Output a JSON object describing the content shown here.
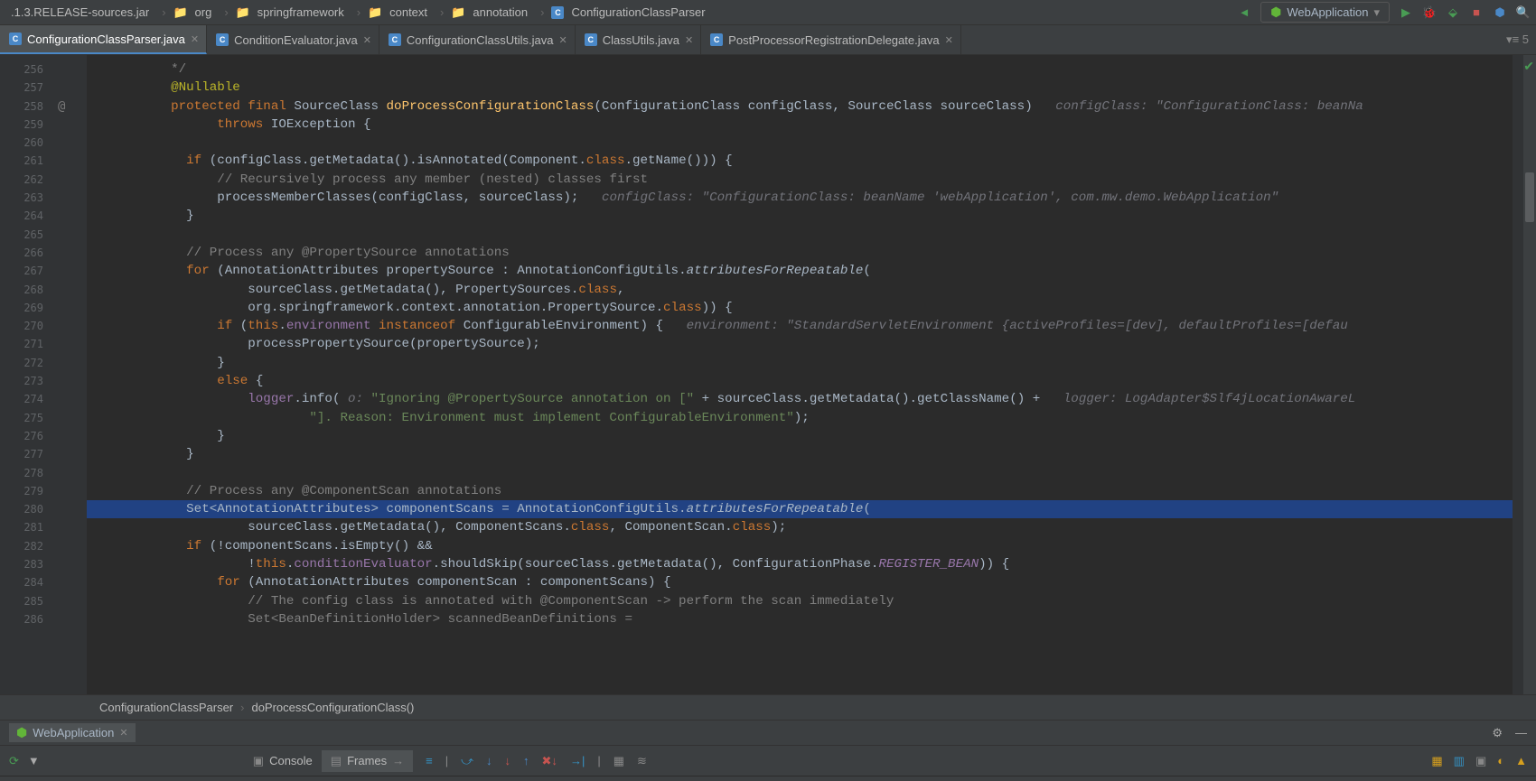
{
  "topbar": {
    "crumbs": [
      ".1.3.RELEASE-sources.jar",
      "org",
      "springframework",
      "context",
      "annotation",
      "ConfigurationClassParser"
    ],
    "runConfig": "WebApplication",
    "tabCount": "5"
  },
  "tabs": [
    {
      "label": "ConfigurationClassParser.java",
      "active": true
    },
    {
      "label": "ConditionEvaluator.java",
      "active": false
    },
    {
      "label": "ConfigurationClassUtils.java",
      "active": false
    },
    {
      "label": "ClassUtils.java",
      "active": false
    },
    {
      "label": "PostProcessorRegistrationDelegate.java",
      "active": false
    }
  ],
  "gutter": {
    "start": 256,
    "end": 286
  },
  "marks": {
    "258": "@"
  },
  "code": {
    "256": {
      "indent": 10,
      "parts": [
        {
          "t": "*/",
          "c": "cm"
        }
      ]
    },
    "257": {
      "indent": 10,
      "parts": [
        {
          "t": "@Nullable",
          "c": "ann"
        }
      ]
    },
    "258": {
      "indent": 10,
      "parts": [
        {
          "t": "protected final ",
          "c": "kw"
        },
        {
          "t": "SourceClass ",
          "c": "txt"
        },
        {
          "t": "doProcessConfigurationClass",
          "c": "fn"
        },
        {
          "t": "(ConfigurationClass configClass, SourceClass sourceClass)   ",
          "c": "txt"
        },
        {
          "t": "configClass: \"ConfigurationClass: beanNa",
          "c": "hint"
        }
      ]
    },
    "259": {
      "indent": 16,
      "parts": [
        {
          "t": "throws ",
          "c": "kw"
        },
        {
          "t": "IOException {",
          "c": "txt"
        }
      ]
    },
    "260": {
      "indent": 0,
      "parts": [
        {
          "t": "",
          "c": "txt"
        }
      ]
    },
    "261": {
      "indent": 12,
      "parts": [
        {
          "t": "if ",
          "c": "kw"
        },
        {
          "t": "(configClass.getMetadata().isAnnotated(",
          "c": "txt"
        },
        {
          "t": "Component",
          "c": "txt"
        },
        {
          "t": ".",
          "c": "txt"
        },
        {
          "t": "class",
          "c": "kw"
        },
        {
          "t": ".getName())) {",
          "c": "txt"
        }
      ]
    },
    "262": {
      "indent": 16,
      "parts": [
        {
          "t": "// Recursively process any member (nested) classes first",
          "c": "cm"
        }
      ]
    },
    "263": {
      "indent": 16,
      "parts": [
        {
          "t": "processMemberClasses(configClass, sourceClass);   ",
          "c": "txt"
        },
        {
          "t": "configClass: \"ConfigurationClass: beanName 'webApplication', com.mw.demo.WebApplication\"",
          "c": "hint"
        }
      ]
    },
    "264": {
      "indent": 12,
      "parts": [
        {
          "t": "}",
          "c": "txt"
        }
      ]
    },
    "265": {
      "indent": 0,
      "parts": [
        {
          "t": "",
          "c": "txt"
        }
      ]
    },
    "266": {
      "indent": 12,
      "parts": [
        {
          "t": "// Process any @PropertySource annotations",
          "c": "cm"
        }
      ]
    },
    "267": {
      "indent": 12,
      "parts": [
        {
          "t": "for ",
          "c": "kw"
        },
        {
          "t": "(AnnotationAttributes propertySource : AnnotationConfigUtils.",
          "c": "txt"
        },
        {
          "t": "attributesForRepeatable",
          "c": "it"
        },
        {
          "t": "(",
          "c": "txt"
        }
      ]
    },
    "268": {
      "indent": 20,
      "parts": [
        {
          "t": "sourceClass.getMetadata(), ",
          "c": "txt"
        },
        {
          "t": "PropertySources",
          "c": "txt"
        },
        {
          "t": ".",
          "c": "txt"
        },
        {
          "t": "class",
          "c": "kw"
        },
        {
          "t": ",",
          "c": "txt"
        }
      ]
    },
    "269": {
      "indent": 20,
      "parts": [
        {
          "t": "org.springframework.context.annotation.",
          "c": "txt"
        },
        {
          "t": "PropertySource",
          "c": "txt"
        },
        {
          "t": ".",
          "c": "txt"
        },
        {
          "t": "class",
          "c": "kw"
        },
        {
          "t": ")) {",
          "c": "txt"
        }
      ]
    },
    "270": {
      "indent": 16,
      "parts": [
        {
          "t": "if ",
          "c": "kw"
        },
        {
          "t": "(",
          "c": "txt"
        },
        {
          "t": "this",
          "c": "kw"
        },
        {
          "t": ".",
          "c": "txt"
        },
        {
          "t": "environment ",
          "c": "fld"
        },
        {
          "t": "instanceof ",
          "c": "kw"
        },
        {
          "t": "ConfigurableEnvironment) {   ",
          "c": "txt"
        },
        {
          "t": "environment: \"StandardServletEnvironment {activeProfiles=[dev], defaultProfiles=[defau",
          "c": "hint"
        }
      ]
    },
    "271": {
      "indent": 20,
      "parts": [
        {
          "t": "processPropertySource(propertySource);",
          "c": "txt"
        }
      ]
    },
    "272": {
      "indent": 16,
      "parts": [
        {
          "t": "}",
          "c": "txt"
        }
      ]
    },
    "273": {
      "indent": 16,
      "parts": [
        {
          "t": "else ",
          "c": "kw"
        },
        {
          "t": "{",
          "c": "txt"
        }
      ]
    },
    "274": {
      "indent": 20,
      "parts": [
        {
          "t": "logger",
          "c": "fld"
        },
        {
          "t": ".info( ",
          "c": "txt"
        },
        {
          "t": "o: ",
          "c": "hint"
        },
        {
          "t": "\"Ignoring @PropertySource annotation on [\" ",
          "c": "str"
        },
        {
          "t": "+ sourceClass.getMetadata().getClassName() +   ",
          "c": "txt"
        },
        {
          "t": "logger: LogAdapter$Slf4jLocationAwareL",
          "c": "hint"
        }
      ]
    },
    "275": {
      "indent": 28,
      "parts": [
        {
          "t": "\"]. Reason: Environment must implement ConfigurableEnvironment\"",
          "c": "str"
        },
        {
          "t": ");",
          "c": "txt"
        }
      ]
    },
    "276": {
      "indent": 16,
      "parts": [
        {
          "t": "}",
          "c": "txt"
        }
      ]
    },
    "277": {
      "indent": 12,
      "parts": [
        {
          "t": "}",
          "c": "txt"
        }
      ]
    },
    "278": {
      "indent": 0,
      "parts": [
        {
          "t": "",
          "c": "txt"
        }
      ]
    },
    "279": {
      "indent": 12,
      "parts": [
        {
          "t": "// Process any @ComponentScan annotations",
          "c": "cm"
        }
      ]
    },
    "280": {
      "indent": 12,
      "hl": true,
      "parts": [
        {
          "t": "Set<AnnotationAttributes> componentScans = AnnotationConfigUtils.",
          "c": "txt"
        },
        {
          "t": "attributesForRepeatable",
          "c": "it"
        },
        {
          "t": "(",
          "c": "txt"
        }
      ]
    },
    "281": {
      "indent": 20,
      "parts": [
        {
          "t": "sourceClass.getMetadata(), ",
          "c": "txt"
        },
        {
          "t": "ComponentScans",
          "c": "txt"
        },
        {
          "t": ".",
          "c": "txt"
        },
        {
          "t": "class",
          "c": "kw"
        },
        {
          "t": ", ",
          "c": "txt"
        },
        {
          "t": "ComponentScan",
          "c": "txt"
        },
        {
          "t": ".",
          "c": "txt"
        },
        {
          "t": "class",
          "c": "kw"
        },
        {
          "t": ");",
          "c": "txt"
        }
      ]
    },
    "282": {
      "indent": 12,
      "parts": [
        {
          "t": "if ",
          "c": "kw"
        },
        {
          "t": "(!componentScans.isEmpty() &&",
          "c": "txt"
        }
      ]
    },
    "283": {
      "indent": 20,
      "parts": [
        {
          "t": "!",
          "c": "txt"
        },
        {
          "t": "this",
          "c": "kw"
        },
        {
          "t": ".",
          "c": "txt"
        },
        {
          "t": "conditionEvaluator",
          "c": "fld"
        },
        {
          "t": ".shouldSkip(sourceClass.getMetadata(), ConfigurationPhase.",
          "c": "txt"
        },
        {
          "t": "REGISTER_BEAN",
          "c": "fld it"
        },
        {
          "t": ")) {",
          "c": "txt"
        }
      ]
    },
    "284": {
      "indent": 16,
      "parts": [
        {
          "t": "for ",
          "c": "kw"
        },
        {
          "t": "(AnnotationAttributes componentScan : componentScans) {",
          "c": "txt"
        }
      ]
    },
    "285": {
      "indent": 20,
      "parts": [
        {
          "t": "// The config class is annotated with @ComponentScan -> perform the scan immediately",
          "c": "cm"
        }
      ]
    },
    "286": {
      "indent": 20,
      "parts": [
        {
          "t": "Set<BeanDefinitionHolder> scannedBeanDefinitions =",
          "c": "cm"
        }
      ]
    }
  },
  "crumbBar": [
    "ConfigurationClassParser",
    "doProcessConfigurationClass()"
  ],
  "toolWindow": {
    "tab": "WebApplication"
  },
  "debug": {
    "console": "Console",
    "frames": "Frames"
  }
}
